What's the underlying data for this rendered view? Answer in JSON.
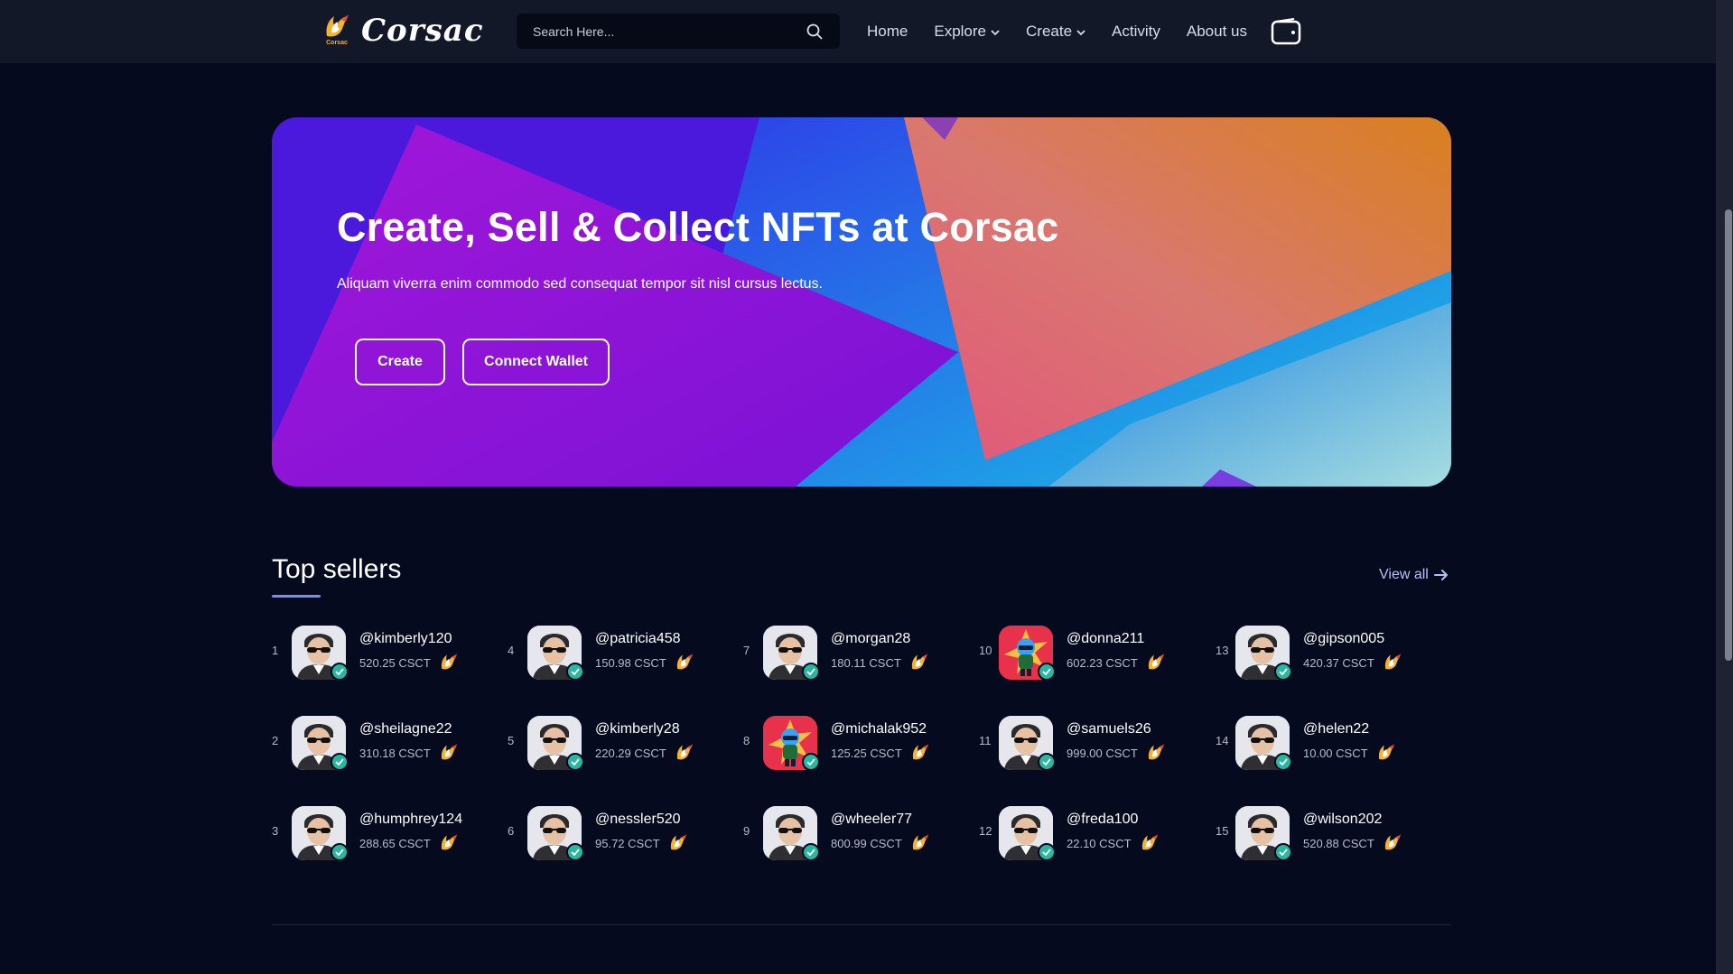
{
  "header": {
    "brand": "Corsac",
    "brand_sub": "Corsac",
    "search_placeholder": "Search Here...",
    "nav": [
      {
        "label": "Home",
        "dropdown": false
      },
      {
        "label": "Explore",
        "dropdown": true
      },
      {
        "label": "Create",
        "dropdown": true
      },
      {
        "label": "Activity",
        "dropdown": false
      },
      {
        "label": "About us",
        "dropdown": false
      }
    ],
    "icons": {
      "search": "search-icon",
      "wallet": "wallet-icon",
      "dropdown": "chevron-down-icon"
    }
  },
  "hero": {
    "title": "Create, Sell & Collect NFTs at Corsac",
    "subtitle": "Aliquam viverra enim commodo sed consequat tempor sit nisl cursus lectus.",
    "create_label": "Create",
    "wallet_label": "Connect Wallet"
  },
  "top_sellers": {
    "title": "Top sellers",
    "view_all": "View all",
    "sellers": [
      {
        "rank": "1",
        "name": "@kimberly120",
        "amount": "520.25 CSCT",
        "avatar": "man"
      },
      {
        "rank": "2",
        "name": "@sheilagne22",
        "amount": "310.18 CSCT",
        "avatar": "man"
      },
      {
        "rank": "3",
        "name": "@humphrey124",
        "amount": "288.65 CSCT",
        "avatar": "man"
      },
      {
        "rank": "4",
        "name": "@patricia458",
        "amount": "150.98 CSCT",
        "avatar": "man"
      },
      {
        "rank": "5",
        "name": "@kimberly28",
        "amount": "220.29 CSCT",
        "avatar": "man"
      },
      {
        "rank": "6",
        "name": "@nessler520",
        "amount": "95.72 CSCT",
        "avatar": "man"
      },
      {
        "rank": "7",
        "name": "@morgan28",
        "amount": "180.11 CSCT",
        "avatar": "man"
      },
      {
        "rank": "8",
        "name": "@michalak952",
        "amount": "125.25 CSCT",
        "avatar": "cartoon"
      },
      {
        "rank": "9",
        "name": "@wheeler77",
        "amount": "800.99 CSCT",
        "avatar": "man"
      },
      {
        "rank": "10",
        "name": "@donna211",
        "amount": "602.23 CSCT",
        "avatar": "cartoon"
      },
      {
        "rank": "11",
        "name": "@samuels26",
        "amount": "999.00 CSCT",
        "avatar": "man"
      },
      {
        "rank": "12",
        "name": "@freda100",
        "amount": "22.10 CSCT",
        "avatar": "man"
      },
      {
        "rank": "13",
        "name": "@gipson005",
        "amount": "420.37 CSCT",
        "avatar": "man"
      },
      {
        "rank": "14",
        "name": "@helen22",
        "amount": "10.00 CSCT",
        "avatar": "man"
      },
      {
        "rank": "15",
        "name": "@wilson202",
        "amount": "520.88 CSCT",
        "avatar": "man"
      }
    ]
  },
  "colors": {
    "background": "#060a1e",
    "header": "#121828",
    "accent": "#7b8cf5",
    "verify": "#2ab7a0",
    "coin": "#f2b233"
  }
}
